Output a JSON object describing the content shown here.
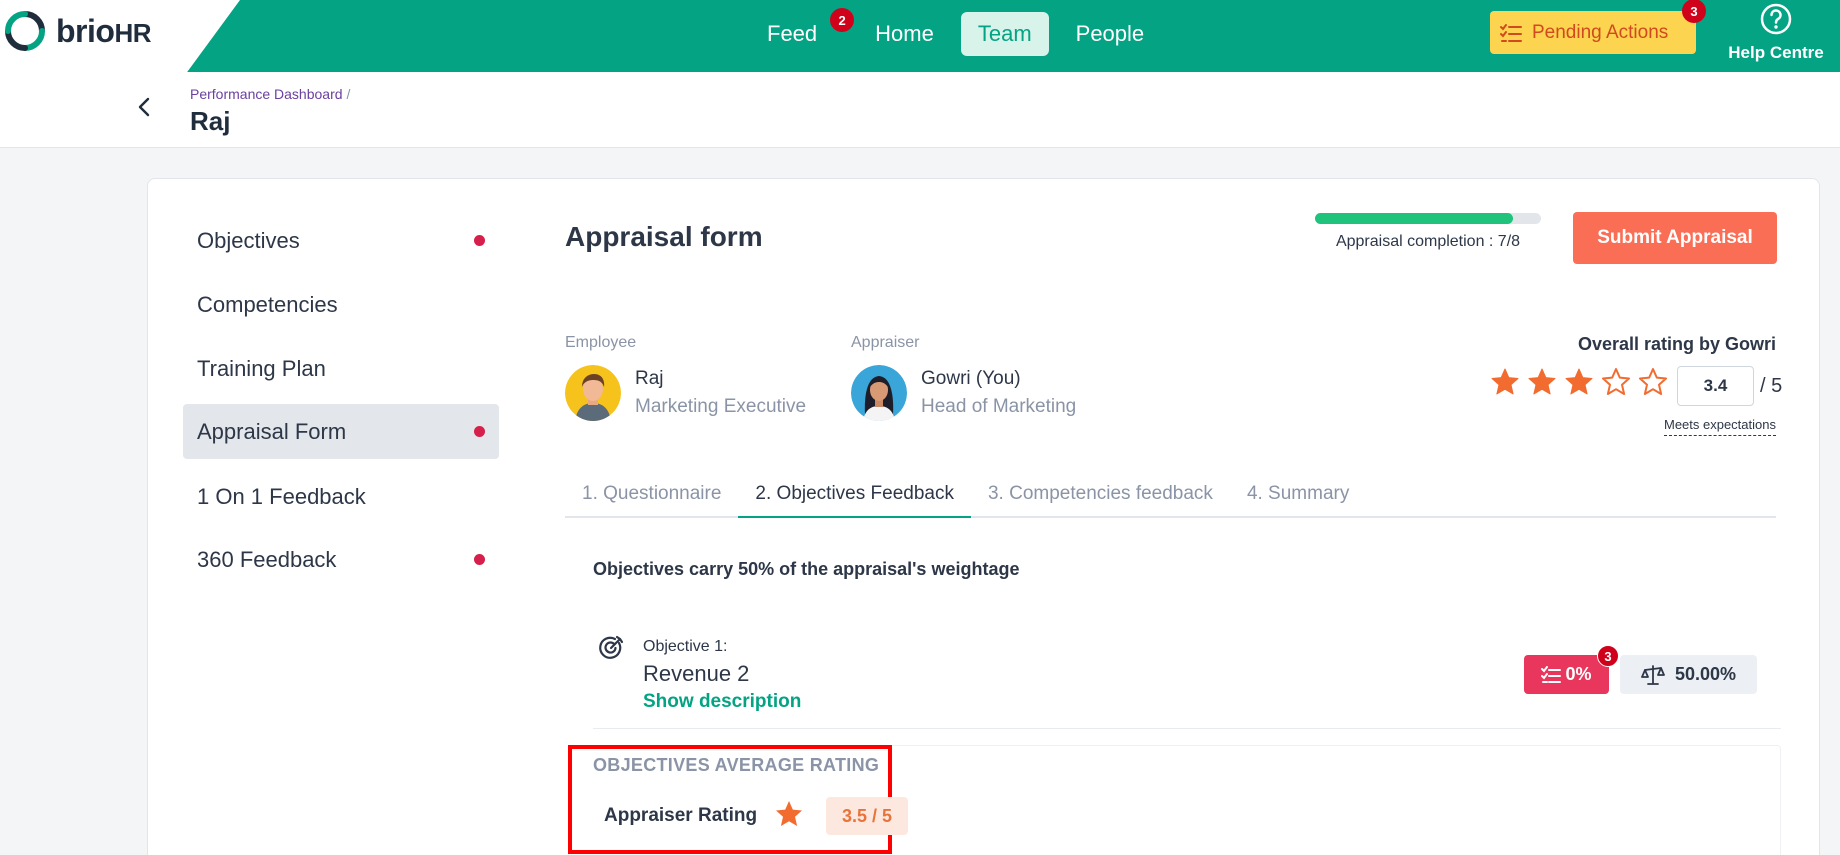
{
  "app": {
    "brand": "brio",
    "brand_suffix": "HR"
  },
  "nav": {
    "items": [
      {
        "label": "Feed",
        "badge": "2"
      },
      {
        "label": "Home"
      },
      {
        "label": "Team",
        "active": true
      },
      {
        "label": "People"
      }
    ],
    "pending": {
      "label": "Pending Actions",
      "badge": "3"
    },
    "help": {
      "label": "Help Centre"
    }
  },
  "breadcrumb": {
    "parent": "Performance Dashboard",
    "separator": "/",
    "title": "Raj"
  },
  "sidebar": {
    "items": [
      {
        "label": "Objectives",
        "dot": true
      },
      {
        "label": "Competencies",
        "dot": false
      },
      {
        "label": "Training Plan",
        "dot": false
      },
      {
        "label": "Appraisal Form",
        "dot": true,
        "active": true
      },
      {
        "label": "1 On 1 Feedback",
        "dot": false
      },
      {
        "label": "360 Feedback",
        "dot": true
      }
    ]
  },
  "form": {
    "title": "Appraisal form",
    "completion_label": "Appraisal completion : 7/8",
    "completion_fraction": 0.875,
    "submit_label": "Submit Appraisal"
  },
  "employee": {
    "label": "Employee",
    "name": "Raj",
    "role": "Marketing Executive"
  },
  "appraiser": {
    "label": "Appraiser",
    "name": "Gowri (You)",
    "role": "Head of Marketing"
  },
  "overall": {
    "label": "Overall rating by Gowri",
    "stars_filled": 3,
    "stars_total": 5,
    "value": "3.4",
    "out_of": "/ 5",
    "descriptor": "Meets expectations"
  },
  "tabs": [
    {
      "label": "1. Questionnaire"
    },
    {
      "label": "2. Objectives Feedback",
      "active": true
    },
    {
      "label": "3. Competencies feedback"
    },
    {
      "label": "4. Summary"
    }
  ],
  "weight_note": "Objectives carry 50% of the appraisal's weightage",
  "objective": {
    "label": "Objective 1:",
    "name": "Revenue 2",
    "show_description": "Show description",
    "progress": "0%",
    "progress_badge": "3",
    "weight": "50.00%"
  },
  "average": {
    "title": "OBJECTIVES AVERAGE RATING",
    "appraiser_label": "Appraiser Rating",
    "appraiser_value": "3.5 / 5"
  },
  "colors": {
    "brand": "#03a383",
    "submit": "#fa6e56",
    "star": "#f26b2f",
    "alert": "#d0021b",
    "highlight": "#ff0000"
  }
}
